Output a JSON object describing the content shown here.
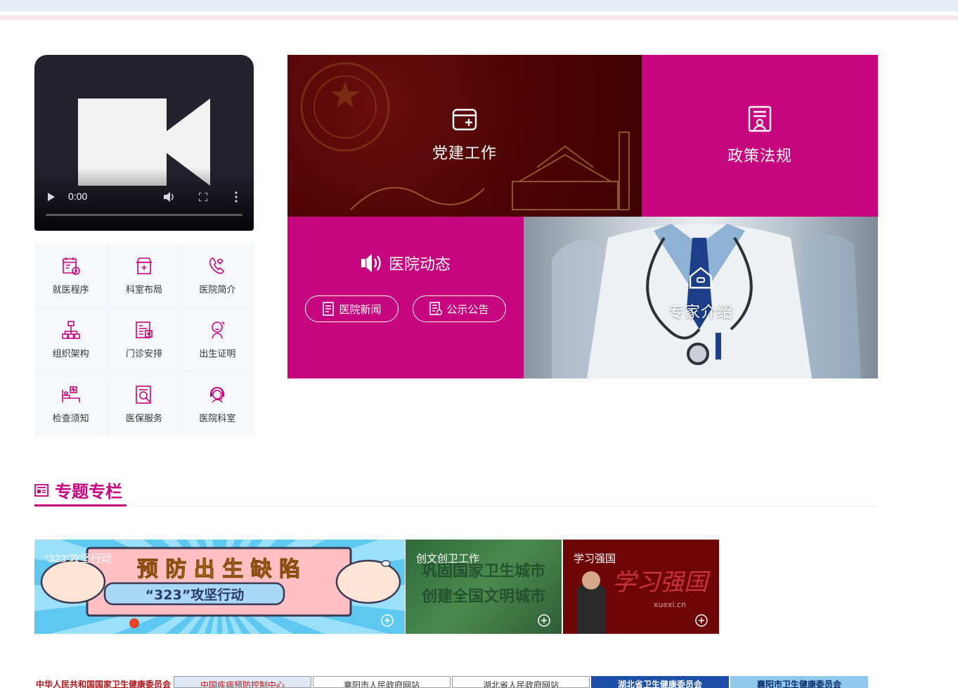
{
  "video": {
    "time": "0:00"
  },
  "quick_links": [
    {
      "label": "就医程序",
      "icon": "calendar-plus-icon"
    },
    {
      "label": "科室布局",
      "icon": "clinic-building-icon"
    },
    {
      "label": "医院简介",
      "icon": "heart-phone-icon"
    },
    {
      "label": "组织架构",
      "icon": "org-chart-icon"
    },
    {
      "label": "门诊安排",
      "icon": "schedule-list-icon"
    },
    {
      "label": "出生证明",
      "icon": "baby-icon"
    },
    {
      "label": "检查须知",
      "icon": "hospital-bed-icon"
    },
    {
      "label": "医保服务",
      "icon": "insurance-search-icon"
    },
    {
      "label": "医院科室",
      "icon": "doctor-headset-icon"
    }
  ],
  "tiles": {
    "party": "党建工作",
    "policy": "政策法规",
    "news": "医院动态",
    "news_btn": "医院新闻",
    "notice_btn": "公示公告",
    "expert": "专家介绍"
  },
  "section": {
    "title": "专题专栏"
  },
  "banners": [
    {
      "caption": "“323”攻坚行动",
      "art_line1": "预 防 出 生 缺 陷",
      "art_line2": "“323”攻坚行动"
    },
    {
      "caption": "创文创卫工作",
      "art_line1": "巩固国家卫生城市",
      "art_line2": "创建全国文明城市"
    },
    {
      "caption": "学习强国",
      "art_line1": "学习强国",
      "art_line2": "xuexi.cn"
    }
  ],
  "footer_links": [
    "中华人民共和国国家卫生健康委员会",
    "中国疾病预防控制中心",
    "襄阳市人民政府网站",
    "湖北省人民政府网站",
    "湖北省卫生健康委员会",
    "襄阳市卫生健康委员会"
  ],
  "colors": {
    "accent": "#c7057f",
    "party_red": "#4d0303"
  }
}
